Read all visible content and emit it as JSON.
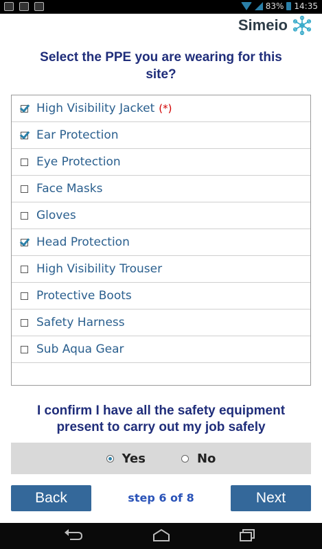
{
  "status_bar": {
    "battery_percent": "83%",
    "time": "14:35",
    "left_icons": [
      "email-icon",
      "image-icon",
      "bag-icon"
    ],
    "right_icons": [
      "wifi-icon",
      "signal-icon",
      "battery-icon"
    ]
  },
  "brand": {
    "name": "Simeio",
    "logo_color": "#35a9c9",
    "text_color": "#2d3c47"
  },
  "question": {
    "line1": "Select the PPE you are wearing for this",
    "line2": "site?"
  },
  "ppe_list": [
    {
      "label": "High Visibility Jacket",
      "checked": true,
      "required_mark": "(*)"
    },
    {
      "label": "Ear Protection",
      "checked": true
    },
    {
      "label": "Eye Protection",
      "checked": false
    },
    {
      "label": "Face Masks",
      "checked": false
    },
    {
      "label": "Gloves",
      "checked": false
    },
    {
      "label": "Head Protection",
      "checked": true
    },
    {
      "label": "High Visibility Trouser",
      "checked": false
    },
    {
      "label": "Protective Boots",
      "checked": false
    },
    {
      "label": "Safety Harness",
      "checked": false
    },
    {
      "label": "Sub Aqua Gear",
      "checked": false
    }
  ],
  "confirm": {
    "line1": "I confirm I have all the safety equipment",
    "line2": "present to carry out my job safely",
    "options": [
      {
        "label": "Yes",
        "selected": true
      },
      {
        "label": "No",
        "selected": false
      }
    ]
  },
  "footer": {
    "back_label": "Back",
    "next_label": "Next",
    "step_text": "step 6 of 8"
  },
  "colors": {
    "title": "#1f2d7a",
    "button": "#34689a",
    "step": "#2a53b8",
    "accent": "#2b80a8",
    "required": "#d10000"
  }
}
